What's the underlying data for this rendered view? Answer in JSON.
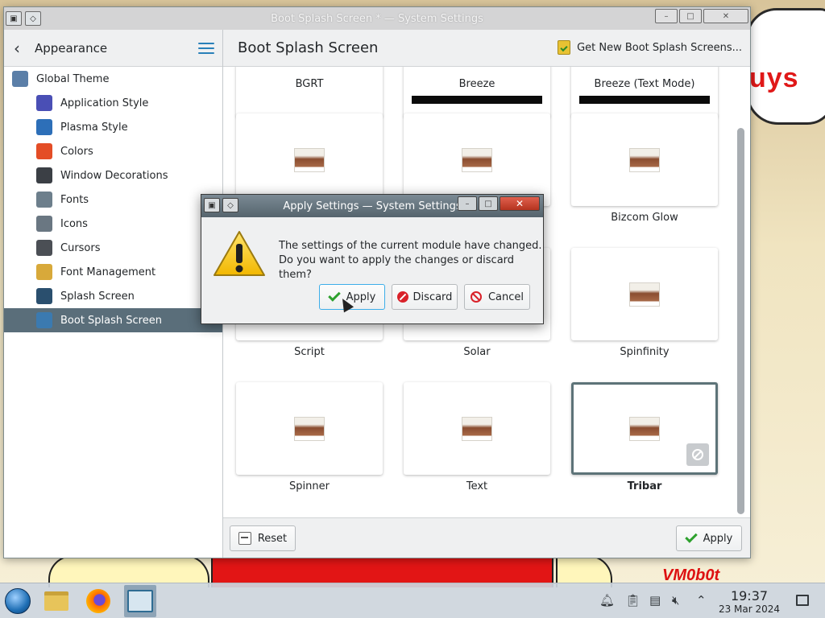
{
  "window": {
    "title": "Boot Splash Screen * — System Settings"
  },
  "sidebar": {
    "header_title": "Appearance",
    "items": [
      {
        "label": "Global Theme",
        "icon": "global-theme-icon",
        "color": "#5b7fa8"
      },
      {
        "label": "Application Style",
        "icon": "application-style-icon",
        "color": "#4a4fb5"
      },
      {
        "label": "Plasma Style",
        "icon": "plasma-style-icon",
        "color": "#2d6fb8"
      },
      {
        "label": "Colors",
        "icon": "colors-icon",
        "color": "#e44d26"
      },
      {
        "label": "Window Decorations",
        "icon": "window-decorations-icon",
        "color": "#3b3f45"
      },
      {
        "label": "Fonts",
        "icon": "fonts-icon",
        "color": "#6d7f8c"
      },
      {
        "label": "Icons",
        "icon": "icons-icon",
        "color": "#6a7782"
      },
      {
        "label": "Cursors",
        "icon": "cursors-icon",
        "color": "#4b4f55"
      },
      {
        "label": "Font Management",
        "icon": "font-management-icon",
        "color": "#d8a93a"
      },
      {
        "label": "Splash Screen",
        "icon": "splash-screen-icon",
        "color": "#2a4f6e"
      },
      {
        "label": "Boot Splash Screen",
        "icon": "boot-splash-screen-icon",
        "color": "#3b7ab0"
      }
    ],
    "selected": "Boot Splash Screen"
  },
  "content": {
    "title": "Boot Splash Screen",
    "get_new_label": "Get New Boot Splash Screens...",
    "themes": [
      {
        "label": "BGRT"
      },
      {
        "label": "Breeze"
      },
      {
        "label": "Breeze (Text Mode)"
      },
      {
        "label": ""
      },
      {
        "label": ""
      },
      {
        "label": "Bizcom Glow"
      },
      {
        "label": "Script"
      },
      {
        "label": "Solar"
      },
      {
        "label": "Spinfinity"
      },
      {
        "label": "Spinner"
      },
      {
        "label": "Text"
      },
      {
        "label": "Tribar",
        "selected": true
      }
    ],
    "reset_label": "Reset",
    "apply_label": "Apply"
  },
  "dialog": {
    "title": "Apply Settings — System Settings",
    "message_line1": "The settings of the current module have changed.",
    "message_line2": "Do you want to apply the changes or discard them?",
    "apply_label": "Apply",
    "discard_label": "Discard",
    "cancel_label": "Cancel"
  },
  "wallpaper": {
    "cloud_text": "uys",
    "signature": "VM0b0t"
  },
  "taskbar": {
    "time": "19:37",
    "date": "23 Mar 2024"
  }
}
